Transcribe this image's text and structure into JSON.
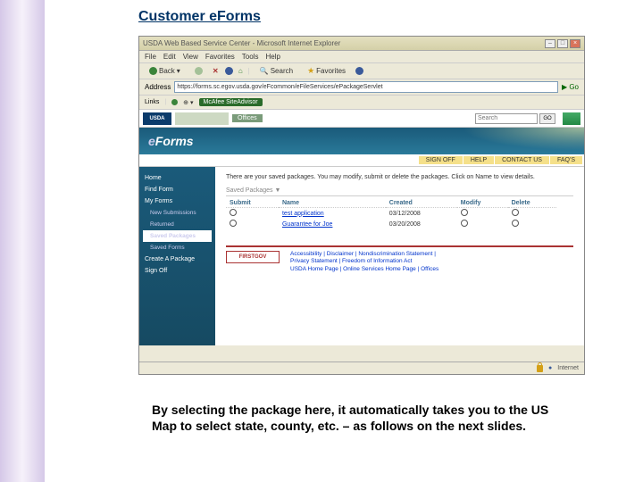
{
  "slide": {
    "title": "Customer eForms",
    "caption": "By selecting the package here, it automatically takes you to the US Map to select state, county, etc. – as follows on the next slides."
  },
  "browser": {
    "window_title": "USDA Web Based Service Center - Microsoft Internet Explorer",
    "menu": [
      "File",
      "Edit",
      "View",
      "Favorites",
      "Tools",
      "Help"
    ],
    "toolbar": {
      "back": "Back",
      "search": "Search",
      "favorites": "Favorites"
    },
    "address_label": "Address",
    "address_value": "https://forms.sc.egov.usda.gov/eFcommon/eFileServices/ePackageServlet",
    "go": "Go",
    "links_label": "Links",
    "links_pill": "McAfee SiteAdvisor"
  },
  "page": {
    "usda_logo": "USDA",
    "offices_tab": "Offices",
    "search_placeholder": "Search",
    "search_go": "GO",
    "eforms_brand_pre": "e",
    "eforms_brand": "Forms",
    "strip": [
      "SIGN OFF",
      "HELP",
      "CONTACT US",
      "FAQ'S"
    ],
    "sidebar": {
      "items": [
        "Home",
        "Find Form",
        "My Forms",
        "New Submissions",
        "Returned",
        "Saved Packages",
        "Saved Forms",
        "Create A Package",
        "Sign Off"
      ],
      "active_index": 5
    },
    "intro": "There are your saved packages. You may modify, submit or delete the packages. Click on Name to view details.",
    "section_head": "Saved Packages ▼",
    "table": {
      "headers": [
        "Submit",
        "Name",
        "Created",
        "Modify",
        "Delete"
      ],
      "rows": [
        {
          "name": "test application",
          "created": "03/12/2008"
        },
        {
          "name": "Guarantee for Joe",
          "created": "03/20/2008"
        }
      ]
    },
    "footer": {
      "firstgov": "FIRSTGOV",
      "line1": "Accessibility | Disclaimer | Nondiscrimination Statement |",
      "line2": "Privacy Statement | Freedom of Information Act",
      "line3": "USDA Home Page | Online Services Home Page | Offices"
    },
    "statusbar_zone": "Internet"
  }
}
